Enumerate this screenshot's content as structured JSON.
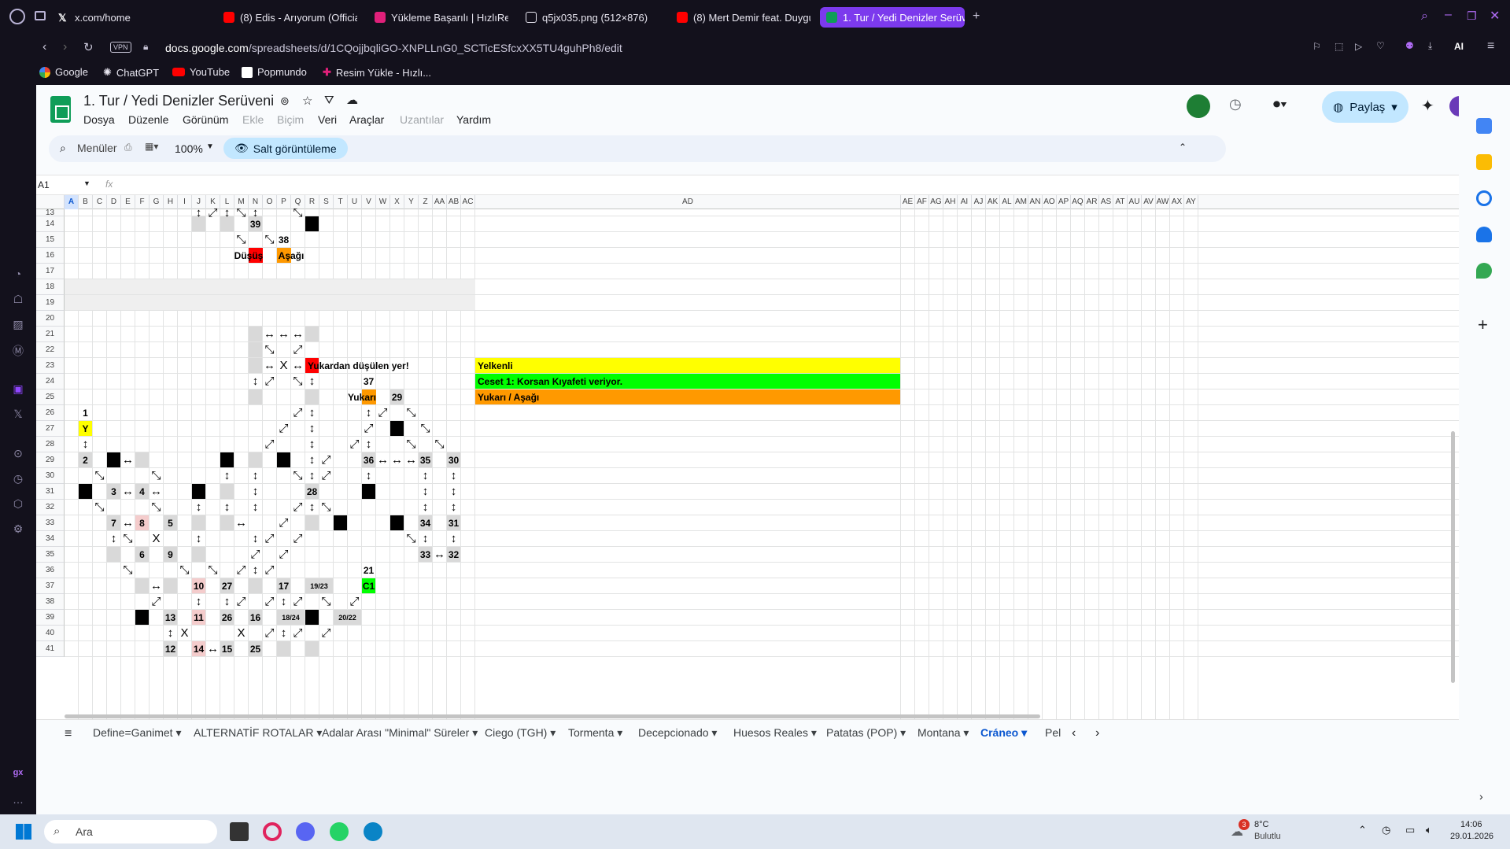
{
  "browser": {
    "tabs": [
      {
        "label": "x.com/home",
        "icon": "x-logo"
      },
      {
        "label": "(8) Edis - Arıyorum (Official",
        "icon": "youtube-logo"
      },
      {
        "label": "Yükleme Başarılı | HızlıRes",
        "icon": "hizliresim-logo"
      },
      {
        "label": "q5jx035.png (512×876)",
        "icon": "file-icon"
      },
      {
        "label": "(8) Mert Demir feat. Duygu",
        "icon": "youtube-logo"
      },
      {
        "label": "1. Tur / Yedi Denizler Serüv",
        "icon": "sheets-logo"
      }
    ],
    "url_host": "docs.google.com",
    "url_path": "/spreadsheets/d/1CQojjbqliGO-XNPLLnG0_SCTicESfcxXX5TU4guhPh8/edit",
    "vpn_label": "VPN",
    "ai_label": "AI",
    "bookmarks": [
      "Google",
      "ChatGPT",
      "YouTube",
      "Popmundo",
      "Resim Yükle - Hızlı..."
    ]
  },
  "doc": {
    "title": "1. Tur / Yedi Denizler Serüveni",
    "menus": [
      "Dosya",
      "Düzenle",
      "Görünüm",
      "Ekle",
      "Biçim",
      "Veri",
      "Araçlar",
      "Uzantılar",
      "Yardım"
    ],
    "search_label": "Menüler",
    "zoom": "100%",
    "view_only_label": "Salt görüntüleme",
    "share_label": "Paylaş",
    "cell_ref": "A1",
    "fx": "fx"
  },
  "grid": {
    "rows": [
      "13",
      "14",
      "15",
      "16",
      "17",
      "18",
      "19",
      "20",
      "21",
      "22",
      "23",
      "24",
      "25",
      "26",
      "27",
      "28",
      "29",
      "30",
      "31",
      "32",
      "33",
      "34",
      "35",
      "36",
      "37",
      "38",
      "39",
      "40",
      "41"
    ],
    "cols": [
      "A",
      "B",
      "C",
      "D",
      "E",
      "F",
      "G",
      "H",
      "I",
      "J",
      "K",
      "L",
      "M",
      "N",
      "O",
      "P",
      "Q",
      "R",
      "S",
      "T",
      "U",
      "V",
      "W",
      "X",
      "Y",
      "Z",
      "AA",
      "AB",
      "AC",
      "AD",
      "AE",
      "AF",
      "AG",
      "AH",
      "AI",
      "AJ",
      "AK",
      "AL",
      "AM",
      "AN",
      "AO",
      "AP",
      "AQ",
      "AR",
      "AS",
      "AT",
      "AU",
      "AV",
      "AW",
      "AX",
      "AY"
    ],
    "cells": [
      {
        "col": "N",
        "row": "14",
        "text": "39",
        "style": "g"
      },
      {
        "col": "P",
        "row": "15",
        "text": "38",
        "style": ""
      },
      {
        "col": "N",
        "row": "16",
        "text": "Düşüş",
        "style": "r"
      },
      {
        "col": "P",
        "row": "16",
        "text": "Aşağı",
        "style": "o"
      },
      {
        "col": "R",
        "row": "23",
        "text": "Yukardan düşülen yer!",
        "style": "r"
      },
      {
        "col": "V",
        "row": "24",
        "text": "37",
        "style": ""
      },
      {
        "col": "V",
        "row": "25",
        "text": "Yukarı",
        "style": "o"
      },
      {
        "col": "X",
        "row": "25",
        "text": "29",
        "style": "g"
      },
      {
        "col": "B",
        "row": "26",
        "text": "1",
        "style": ""
      },
      {
        "col": "B",
        "row": "27",
        "text": "Y",
        "style": "y"
      },
      {
        "col": "B",
        "row": "29",
        "text": "2",
        "style": "g"
      },
      {
        "col": "V",
        "row": "29",
        "text": "36",
        "style": "g"
      },
      {
        "col": "Z",
        "row": "29",
        "text": "35",
        "style": "g"
      },
      {
        "col": "AB",
        "row": "29",
        "text": "30",
        "style": "g"
      },
      {
        "col": "D",
        "row": "31",
        "text": "3",
        "style": "g"
      },
      {
        "col": "F",
        "row": "31",
        "text": "4",
        "style": "g"
      },
      {
        "col": "R",
        "row": "31",
        "text": "28",
        "style": "g"
      },
      {
        "col": "D",
        "row": "33",
        "text": "7",
        "style": "g"
      },
      {
        "col": "F",
        "row": "33",
        "text": "8",
        "style": "p"
      },
      {
        "col": "H",
        "row": "33",
        "text": "5",
        "style": "g"
      },
      {
        "col": "Z",
        "row": "33",
        "text": "34",
        "style": "g"
      },
      {
        "col": "AB",
        "row": "33",
        "text": "31",
        "style": "g"
      },
      {
        "col": "F",
        "row": "35",
        "text": "6",
        "style": "g"
      },
      {
        "col": "H",
        "row": "35",
        "text": "9",
        "style": "g"
      },
      {
        "col": "Z",
        "row": "35",
        "text": "33",
        "style": "g"
      },
      {
        "col": "AB",
        "row": "35",
        "text": "32",
        "style": "g"
      },
      {
        "col": "V",
        "row": "36",
        "text": "21",
        "style": ""
      },
      {
        "col": "J",
        "row": "37",
        "text": "10",
        "style": "p"
      },
      {
        "col": "L",
        "row": "37",
        "text": "27",
        "style": "g"
      },
      {
        "col": "P",
        "row": "37",
        "text": "17",
        "style": "g"
      },
      {
        "col": "R",
        "row": "37",
        "text": "19/23",
        "style": "g"
      },
      {
        "col": "V",
        "row": "37",
        "text": "C1",
        "style": "gr"
      },
      {
        "col": "H",
        "row": "39",
        "text": "13",
        "style": "g"
      },
      {
        "col": "J",
        "row": "39",
        "text": "11",
        "style": "p"
      },
      {
        "col": "L",
        "row": "39",
        "text": "26",
        "style": "g"
      },
      {
        "col": "N",
        "row": "39",
        "text": "16",
        "style": "g"
      },
      {
        "col": "P",
        "row": "39",
        "text": "18/24",
        "style": "g"
      },
      {
        "col": "T",
        "row": "39",
        "text": "20/22",
        "style": "g"
      },
      {
        "col": "H",
        "row": "41",
        "text": "12",
        "style": "g"
      },
      {
        "col": "J",
        "row": "41",
        "text": "14",
        "style": "p"
      },
      {
        "col": "L",
        "row": "41",
        "text": "15",
        "style": "g"
      },
      {
        "col": "N",
        "row": "41",
        "text": "25",
        "style": "g"
      }
    ],
    "legend": [
      {
        "text": "Yelkenli",
        "color": "#ffff00"
      },
      {
        "text": "Ceset 1: Korsan Kıyafeti veriyor.",
        "color": "#00ff00"
      },
      {
        "text": "Yukarı / Aşağı",
        "color": "#ff9900"
      }
    ]
  },
  "sheet_tabs": [
    "Define=Ganimet",
    "ALTERNATİF ROTALAR",
    "Adalar Arası \"Minimal\" Süreler",
    "Ciego (TGH)",
    "Tormenta",
    "Decepcionado",
    "Huesos Reales",
    "Patatas (POP)",
    "Montana",
    "Cráneo",
    "Pel"
  ],
  "active_sheet": "Cráneo",
  "taskbar": {
    "search_placeholder": "Ara",
    "weather_temp": "8°C",
    "weather_desc": "Bulutlu",
    "weather_badge": "3",
    "time": "14:06",
    "date": "29.01.2026"
  }
}
